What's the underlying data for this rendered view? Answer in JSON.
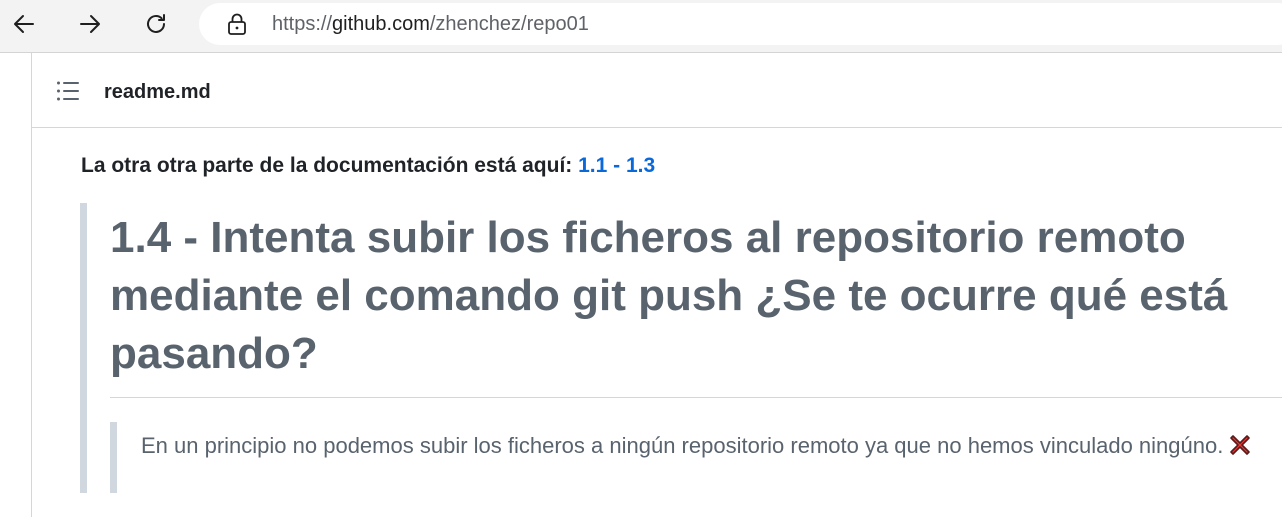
{
  "browser": {
    "back_icon": "arrow-left-icon",
    "forward_icon": "arrow-right-icon",
    "reload_icon": "reload-icon",
    "lock_icon": "lock-icon",
    "url_scheme": "https://",
    "url_host": "github.com",
    "url_path": "/zhenchez/repo01"
  },
  "file": {
    "outline_icon": "list-icon",
    "name": "readme.md"
  },
  "content": {
    "intro_text": "La otra otra parte de la documentación está aquí:",
    "intro_link": "1.1 - 1.3",
    "heading": "1.4 - Intenta subir los ficheros al repositorio remoto mediante el comando git push ¿Se te ocurre qué está pasando?",
    "answer": "En un principio no podemos subir los ficheros a ningún repositorio remoto ya que no hemos vinculado ningúno.",
    "answer_icon": "cross-mark-icon"
  },
  "colors": {
    "link": "#0969da",
    "muted_text": "#59636e",
    "border": "#d0d7de",
    "cross_red": "#e53935"
  }
}
